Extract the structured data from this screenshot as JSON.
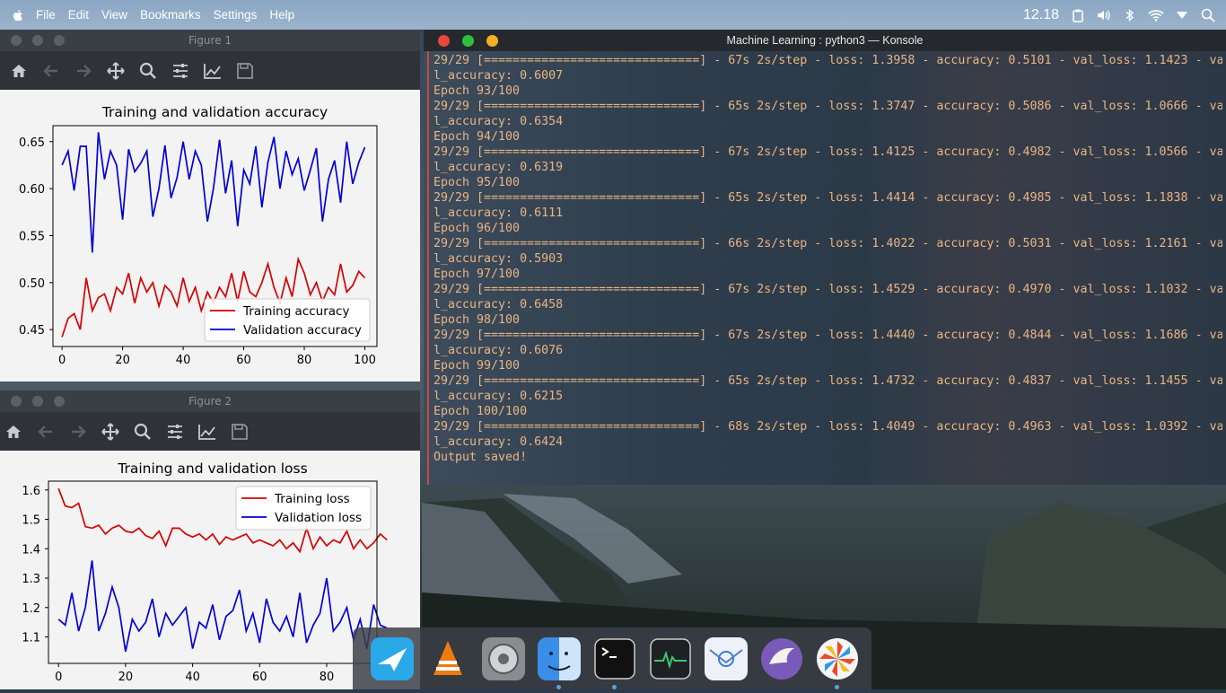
{
  "menubar": {
    "items": [
      "File",
      "Edit",
      "View",
      "Bookmarks",
      "Settings",
      "Help"
    ],
    "clock": "12.18"
  },
  "figure1": {
    "window_title": "Figure 1",
    "chart_data": {
      "type": "line",
      "title": "Training and validation accuracy",
      "xlabel": "",
      "ylabel": "",
      "xlim": [
        -3,
        104
      ],
      "ylim": [
        0.432,
        0.667
      ],
      "xticks": [
        "0",
        "20",
        "40",
        "60",
        "80",
        "100"
      ],
      "yticks": [
        "0.45",
        "0.50",
        "0.55",
        "0.60",
        "0.65"
      ],
      "legend_position": "lower-right",
      "series": [
        {
          "name": "Training accuracy",
          "color": "#d40000",
          "x": [
            0,
            2,
            4,
            6,
            8,
            10,
            12,
            14,
            16,
            18,
            20,
            22,
            24,
            26,
            28,
            30,
            32,
            34,
            36,
            38,
            40,
            42,
            44,
            46,
            48,
            50,
            52,
            54,
            56,
            58,
            60,
            62,
            64,
            66,
            68,
            70,
            72,
            74,
            76,
            78,
            80,
            82,
            84,
            86,
            88,
            90,
            92,
            94,
            96,
            98,
            100
          ],
          "values": [
            0.442,
            0.462,
            0.467,
            0.45,
            0.505,
            0.47,
            0.484,
            0.488,
            0.47,
            0.495,
            0.488,
            0.51,
            0.478,
            0.505,
            0.49,
            0.5,
            0.475,
            0.497,
            0.49,
            0.475,
            0.505,
            0.48,
            0.495,
            0.47,
            0.49,
            0.478,
            0.495,
            0.485,
            0.51,
            0.48,
            0.512,
            0.49,
            0.485,
            0.5,
            0.52,
            0.495,
            0.478,
            0.505,
            0.485,
            0.525,
            0.51,
            0.487,
            0.5,
            0.48,
            0.495,
            0.487,
            0.52,
            0.49,
            0.497,
            0.512,
            0.505
          ]
        },
        {
          "name": "Validation accuracy",
          "color": "#0000d4",
          "x": [
            0,
            2,
            4,
            6,
            8,
            10,
            12,
            14,
            16,
            18,
            20,
            22,
            24,
            26,
            28,
            30,
            32,
            34,
            36,
            38,
            40,
            42,
            44,
            46,
            48,
            50,
            52,
            54,
            56,
            58,
            60,
            62,
            64,
            66,
            68,
            70,
            72,
            74,
            76,
            78,
            80,
            82,
            84,
            86,
            88,
            90,
            92,
            94,
            96,
            98,
            100
          ],
          "values": [
            0.625,
            0.64,
            0.598,
            0.645,
            0.645,
            0.532,
            0.66,
            0.61,
            0.64,
            0.625,
            0.567,
            0.642,
            0.618,
            0.627,
            0.64,
            0.57,
            0.6,
            0.646,
            0.59,
            0.612,
            0.65,
            0.61,
            0.64,
            0.625,
            0.565,
            0.6,
            0.652,
            0.595,
            0.63,
            0.56,
            0.62,
            0.605,
            0.645,
            0.58,
            0.628,
            0.655,
            0.6,
            0.64,
            0.615,
            0.632,
            0.598,
            0.62,
            0.643,
            0.565,
            0.61,
            0.63,
            0.585,
            0.65,
            0.605,
            0.628,
            0.644
          ]
        }
      ]
    }
  },
  "figure2": {
    "window_title": "Figure 2",
    "chart_data": {
      "type": "line",
      "title": "Training and validation loss",
      "xlabel": "",
      "ylabel": "",
      "xlim": [
        -3,
        95
      ],
      "ylim": [
        1.01,
        1.63
      ],
      "xticks": [
        "0",
        "20",
        "40",
        "60",
        "80"
      ],
      "yticks": [
        "1.1",
        "1.2",
        "1.3",
        "1.4",
        "1.5",
        "1.6"
      ],
      "legend_position": "upper-right",
      "series": [
        {
          "name": "Training loss",
          "color": "#d40000",
          "x": [
            0,
            2,
            4,
            6,
            8,
            10,
            12,
            14,
            16,
            18,
            20,
            22,
            24,
            26,
            28,
            30,
            32,
            34,
            36,
            38,
            40,
            42,
            44,
            46,
            48,
            50,
            52,
            54,
            56,
            58,
            60,
            62,
            64,
            66,
            68,
            70,
            72,
            74,
            76,
            78,
            80,
            82,
            84,
            86,
            88,
            90,
            92,
            94,
            96,
            98
          ],
          "values": [
            1.605,
            1.545,
            1.54,
            1.555,
            1.475,
            1.47,
            1.48,
            1.45,
            1.47,
            1.48,
            1.46,
            1.455,
            1.47,
            1.445,
            1.435,
            1.46,
            1.41,
            1.47,
            1.47,
            1.45,
            1.44,
            1.45,
            1.43,
            1.45,
            1.415,
            1.44,
            1.43,
            1.44,
            1.45,
            1.42,
            1.43,
            1.42,
            1.41,
            1.43,
            1.4,
            1.42,
            1.39,
            1.47,
            1.4,
            1.44,
            1.41,
            1.43,
            1.42,
            1.46,
            1.4,
            1.43,
            1.4,
            1.42,
            1.45,
            1.43
          ]
        },
        {
          "name": "Validation loss",
          "color": "#0000d4",
          "x": [
            0,
            2,
            4,
            6,
            8,
            10,
            12,
            14,
            16,
            18,
            20,
            22,
            24,
            26,
            28,
            30,
            32,
            34,
            36,
            38,
            40,
            42,
            44,
            46,
            48,
            50,
            52,
            54,
            56,
            58,
            60,
            62,
            64,
            66,
            68,
            70,
            72,
            74,
            76,
            78,
            80,
            82,
            84,
            86,
            88,
            90,
            92,
            94,
            96,
            98
          ],
          "values": [
            1.16,
            1.14,
            1.25,
            1.12,
            1.2,
            1.36,
            1.12,
            1.18,
            1.27,
            1.2,
            1.05,
            1.16,
            1.12,
            1.15,
            1.23,
            1.1,
            1.18,
            1.14,
            1.17,
            1.2,
            1.06,
            1.15,
            1.13,
            1.21,
            1.09,
            1.17,
            1.19,
            1.26,
            1.12,
            1.18,
            1.08,
            1.23,
            1.15,
            1.12,
            1.17,
            1.1,
            1.25,
            1.08,
            1.14,
            1.18,
            1.3,
            1.12,
            1.15,
            1.2,
            1.09,
            1.16,
            1.06,
            1.21,
            1.14,
            1.13
          ]
        }
      ]
    }
  },
  "konsole": {
    "window_title": "Machine Learning : python3 — Konsole",
    "lines": [
      "29/29 [==============================] - 67s 2s/step - loss: 1.3958 - accuracy: 0.5101 - val_loss: 1.1423 - va",
      "l_accuracy: 0.6007",
      "Epoch 93/100",
      "29/29 [==============================] - 65s 2s/step - loss: 1.3747 - accuracy: 0.5086 - val_loss: 1.0666 - va",
      "l_accuracy: 0.6354",
      "Epoch 94/100",
      "29/29 [==============================] - 67s 2s/step - loss: 1.4125 - accuracy: 0.4982 - val_loss: 1.0566 - va",
      "l_accuracy: 0.6319",
      "Epoch 95/100",
      "29/29 [==============================] - 65s 2s/step - loss: 1.4414 - accuracy: 0.4985 - val_loss: 1.1838 - va",
      "l_accuracy: 0.6111",
      "Epoch 96/100",
      "29/29 [==============================] - 66s 2s/step - loss: 1.4022 - accuracy: 0.5031 - val_loss: 1.2161 - va",
      "l_accuracy: 0.5903",
      "Epoch 97/100",
      "29/29 [==============================] - 67s 2s/step - loss: 1.4529 - accuracy: 0.4970 - val_loss: 1.1032 - va",
      "l_accuracy: 0.6458",
      "Epoch 98/100",
      "29/29 [==============================] - 67s 2s/step - loss: 1.4440 - accuracy: 0.4844 - val_loss: 1.1686 - va",
      "l_accuracy: 0.6076",
      "Epoch 99/100",
      "29/29 [==============================] - 65s 2s/step - loss: 1.4732 - accuracy: 0.4837 - val_loss: 1.1455 - va",
      "l_accuracy: 0.6215",
      "Epoch 100/100",
      "29/29 [==============================] - 68s 2s/step - loss: 1.4049 - accuracy: 0.4963 - val_loss: 1.0392 - va",
      "l_accuracy: 0.6424",
      "Output saved!"
    ]
  },
  "dock": {
    "items": [
      {
        "icon": "kite-app-icon",
        "color": "#2aa8e8",
        "running": false
      },
      {
        "icon": "vlc-icon",
        "color": "#f07a10",
        "running": false
      },
      {
        "icon": "system-settings-icon",
        "color": "#9a9ca0",
        "running": false
      },
      {
        "icon": "finder-icon",
        "color": "#3a8ee8",
        "running": true
      },
      {
        "icon": "terminal-icon",
        "color": "#1c1e22",
        "running": true
      },
      {
        "icon": "activity-monitor-icon",
        "color": "#2a2c30",
        "running": false
      },
      {
        "icon": "mail-icon",
        "color": "#eaeef4",
        "running": false
      },
      {
        "icon": "eagle-browser-icon",
        "color": "#7a5ab8",
        "running": false
      },
      {
        "icon": "pinwheel-app-icon",
        "color": "#f4f4f4",
        "running": true
      }
    ]
  }
}
